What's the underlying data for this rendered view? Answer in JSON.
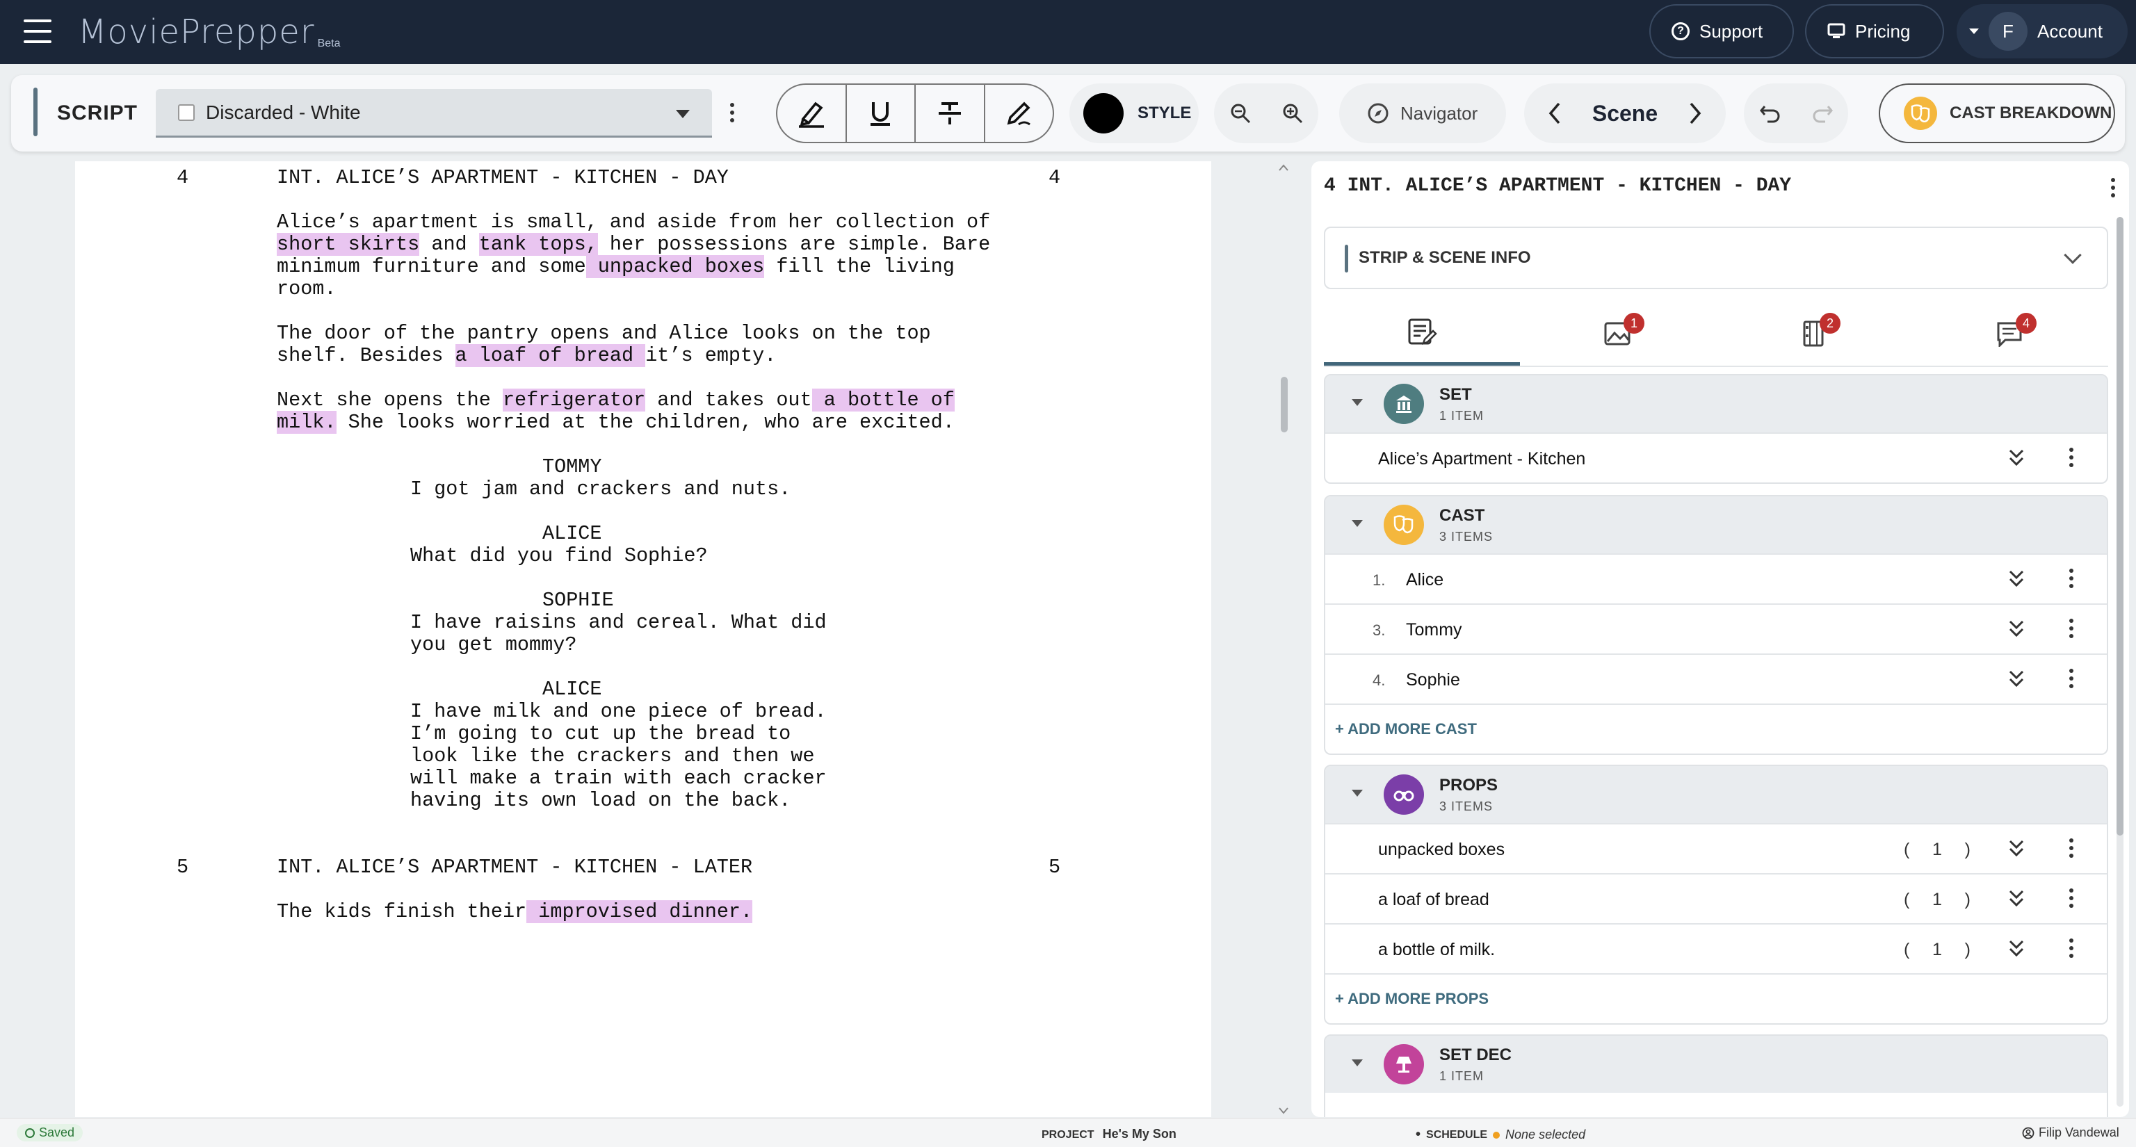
{
  "app": {
    "logo": "MoviePrepper",
    "beta": "Beta"
  },
  "topbar": {
    "support": "Support",
    "pricing": "Pricing",
    "avatar_initial": "F",
    "account": "Account"
  },
  "toolbar": {
    "script_label": "SCRIPT",
    "draft": "Discarded - White",
    "style_label": "STYLE",
    "navigator": "Navigator",
    "scene_label": "Scene",
    "cast_breakdown": "CAST BREAKDOWN"
  },
  "script": {
    "scene4_num": "4",
    "scene4_heading": "INT. ALICE’S APARTMENT - KITCHEN - DAY",
    "p1": [
      "Alice’s apartment is small, and aside from her collection of"
    ],
    "hl_short_skirts": "short skirts",
    "t_and": " and ",
    "hl_tank_tops": "tank tops,",
    "t_possessions": " her possessions are simple. Bare",
    "t_minimum": "minimum furniture and some",
    "hl_unpacked": " unpacked boxes",
    "t_fill": " fill the living",
    "t_room": "room.",
    "t_door": "The door of the pantry opens and Alice looks on the top",
    "t_shelf": "shelf. Besides ",
    "hl_loaf": "a loaf of bread ",
    "t_empty": "it’s empty.",
    "t_next": "Next she opens the ",
    "hl_fridge": "refrigerator",
    "t_takes": " and takes out",
    "hl_bottle1": " a bottle of",
    "hl_bottle2": "milk.",
    "t_worried": " She looks worried at the children, who are excited.",
    "c_tommy": "TOMMY",
    "d_tommy": "I got jam and crackers and nuts.",
    "c_alice1": "ALICE",
    "d_alice1": "What did you find Sophie?",
    "c_sophie": "SOPHIE",
    "d_sophie1": "I have raisins and cereal. What did",
    "d_sophie2": "you get mommy?",
    "c_alice2": "ALICE",
    "d_alice2_1": "I have milk and one piece of bread.",
    "d_alice2_2": "I’m going to cut up the bread to",
    "d_alice2_3": "look like the crackers and then we",
    "d_alice2_4": "will make a train with each cracker",
    "d_alice2_5": "having its own load on the back.",
    "scene5_num": "5",
    "scene5_heading": "INT. ALICE’S APARTMENT - KITCHEN - LATER",
    "t_kids": "The kids finish their",
    "hl_dinner": " improvised dinner."
  },
  "panel": {
    "title": "4 INT. ALICE’S APARTMENT - KITCHEN - DAY",
    "strip_info": "STRIP & SCENE INFO",
    "tab_badges": [
      "1",
      "2",
      "4"
    ],
    "set": {
      "name": "SET",
      "count": "1 ITEM",
      "items": [
        "Alice’s Apartment - Kitchen"
      ]
    },
    "cast": {
      "name": "CAST",
      "count": "3 ITEMS",
      "items": [
        {
          "num": "1.",
          "name": "Alice"
        },
        {
          "num": "3.",
          "name": "Tommy"
        },
        {
          "num": "4.",
          "name": "Sophie"
        }
      ],
      "add": "+ ADD MORE CAST"
    },
    "props": {
      "name": "PROPS",
      "count": "3 ITEMS",
      "items": [
        {
          "name": "unpacked boxes",
          "qty": "1"
        },
        {
          "name": "a loaf of bread",
          "qty": "1"
        },
        {
          "name": "a bottle of milk.",
          "qty": "1"
        }
      ],
      "add": "+ ADD MORE PROPS",
      "paren_open": "(",
      "paren_close": ")"
    },
    "setdec": {
      "name": "SET DEC",
      "count": "1 ITEM"
    }
  },
  "status": {
    "saved": "Saved",
    "project_label": "PROJECT",
    "project": "He's My Son",
    "schedule_label": "SCHEDULE",
    "schedule": "None selected",
    "user": "Filip Vandewal"
  },
  "colors": {
    "highlight": "#e9c5f0",
    "topbar": "#1b2638",
    "cast": "#f4b73d",
    "props": "#7b3ea8",
    "setdec": "#c2439a",
    "set": "#4f7d80"
  }
}
